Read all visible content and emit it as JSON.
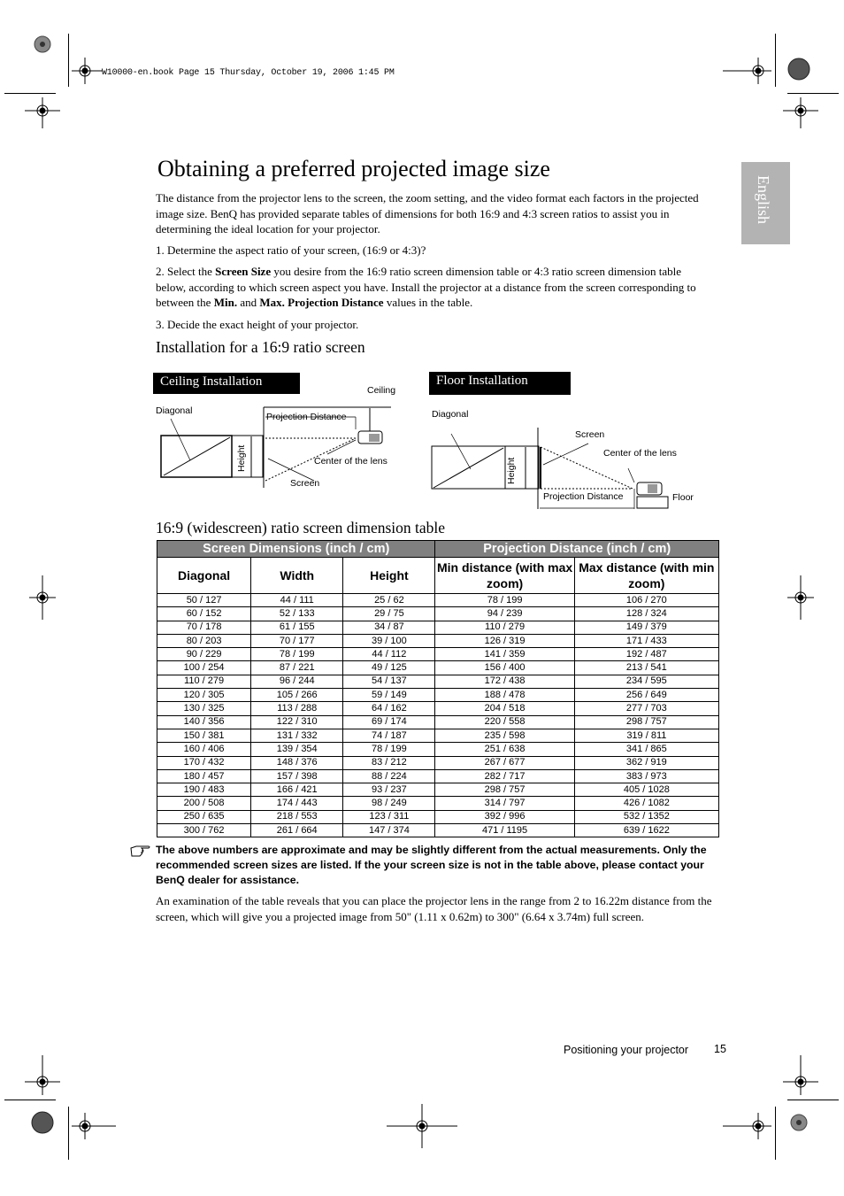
{
  "print_header": "W10000-en.book  Page 15  Thursday, October 19, 2006  1:45 PM",
  "language_tab": "English",
  "page_title": "Obtaining a preferred projected image size",
  "intro": "The distance from the projector lens to the screen, the zoom setting, and the video format each factors in the projected image size. BenQ has provided separate tables of dimensions for both 16:9 and 4:3 screen ratios to assist you in determining the ideal location for your projector.",
  "steps": {
    "step1": "1. Determine the aspect ratio of your screen, (16:9 or 4:3)?",
    "step2_a": "2. Select the ",
    "step2_b": "Screen Size",
    "step2_c": " you desire from the 16:9 ratio screen dimension table or 4:3 ratio screen dimension table below, according to which screen aspect you have. Install the projector at a distance from the screen corresponding to between the ",
    "step2_d": "Min.",
    "step2_e": " and ",
    "step2_f": "Max. Projection Distance",
    "step2_g": " values in the table.",
    "step3": "3. Decide the exact height of your projector."
  },
  "section_heading": "Installation for a 16:9 ratio screen",
  "diagrams": {
    "ceiling": {
      "label": "Ceiling Installation",
      "ceiling": "Ceiling",
      "diagonal": "Diagonal",
      "projection_distance": "Projection Distance",
      "height": "Height",
      "center_lens": "Center of the lens",
      "screen": "Screen"
    },
    "floor": {
      "label": "Floor Installation",
      "diagonal": "Diagonal",
      "screen": "Screen",
      "center_lens": "Center of the lens",
      "height": "Height",
      "projection_distance": "Projection Distance",
      "floor": "Floor"
    }
  },
  "table_heading": "16:9 (widescreen) ratio screen dimension table",
  "table": {
    "group_headers": [
      "Screen Dimensions (inch / cm)",
      "Projection Distance (inch / cm)"
    ],
    "columns": [
      "Diagonal",
      "Width",
      "Height",
      "Min distance (with max zoom)",
      "Max distance (with min zoom)"
    ],
    "rows": [
      [
        "50 / 127",
        "44 / 111",
        "25 / 62",
        "78 / 199",
        "106 / 270"
      ],
      [
        "60 / 152",
        "52 / 133",
        "29 / 75",
        "94 / 239",
        "128 / 324"
      ],
      [
        "70 / 178",
        "61 / 155",
        "34 / 87",
        "110 / 279",
        "149 / 379"
      ],
      [
        "80 / 203",
        "70 / 177",
        "39 / 100",
        "126 / 319",
        "171 / 433"
      ],
      [
        "90 / 229",
        "78 / 199",
        "44 / 112",
        "141 / 359",
        "192 / 487"
      ],
      [
        "100 / 254",
        "87 / 221",
        "49 / 125",
        "156 / 400",
        "213 / 541"
      ],
      [
        "110 / 279",
        "96 / 244",
        "54 / 137",
        "172 / 438",
        "234 / 595"
      ],
      [
        "120 / 305",
        "105 / 266",
        "59 / 149",
        "188 / 478",
        "256 / 649"
      ],
      [
        "130 / 325",
        "113 / 288",
        "64 / 162",
        "204 / 518",
        "277 / 703"
      ],
      [
        "140 / 356",
        "122 / 310",
        "69 / 174",
        "220 / 558",
        "298 / 757"
      ],
      [
        "150 / 381",
        "131 / 332",
        "74 / 187",
        "235 / 598",
        "319 / 811"
      ],
      [
        "160 / 406",
        "139 / 354",
        "78 / 199",
        "251 / 638",
        "341 / 865"
      ],
      [
        "170 / 432",
        "148 / 376",
        "83 / 212",
        "267 / 677",
        "362 / 919"
      ],
      [
        "180 / 457",
        "157 / 398",
        "88 / 224",
        "282 / 717",
        "383 / 973"
      ],
      [
        "190 / 483",
        "166 / 421",
        "93 / 237",
        "298 / 757",
        "405 / 1028"
      ],
      [
        "200 / 508",
        "174 / 443",
        "98 / 249",
        "314 / 797",
        "426 / 1082"
      ],
      [
        "250 / 635",
        "218 / 553",
        "123 / 311",
        "392 / 996",
        "532 / 1352"
      ],
      [
        "300 / 762",
        "261 / 664",
        "147 / 374",
        "471 / 1195",
        "639 / 1622"
      ]
    ]
  },
  "note": "The above numbers are approximate and may be slightly different from the actual measurements. Only the recommended screen sizes are listed. If the your screen size is not in the table above, please contact your BenQ dealer for assistance.",
  "note_icon": "pointing-hand-icon",
  "conclusion": "An examination of the table reveals that you can place the projector lens in the range from 2 to 16.22m distance from the screen, which will give you a projected image from 50\" (1.11 x 0.62m) to 300\" (6.64 x 3.74m) full screen.",
  "footer": {
    "section": "Positioning your projector",
    "page_number": "15"
  }
}
